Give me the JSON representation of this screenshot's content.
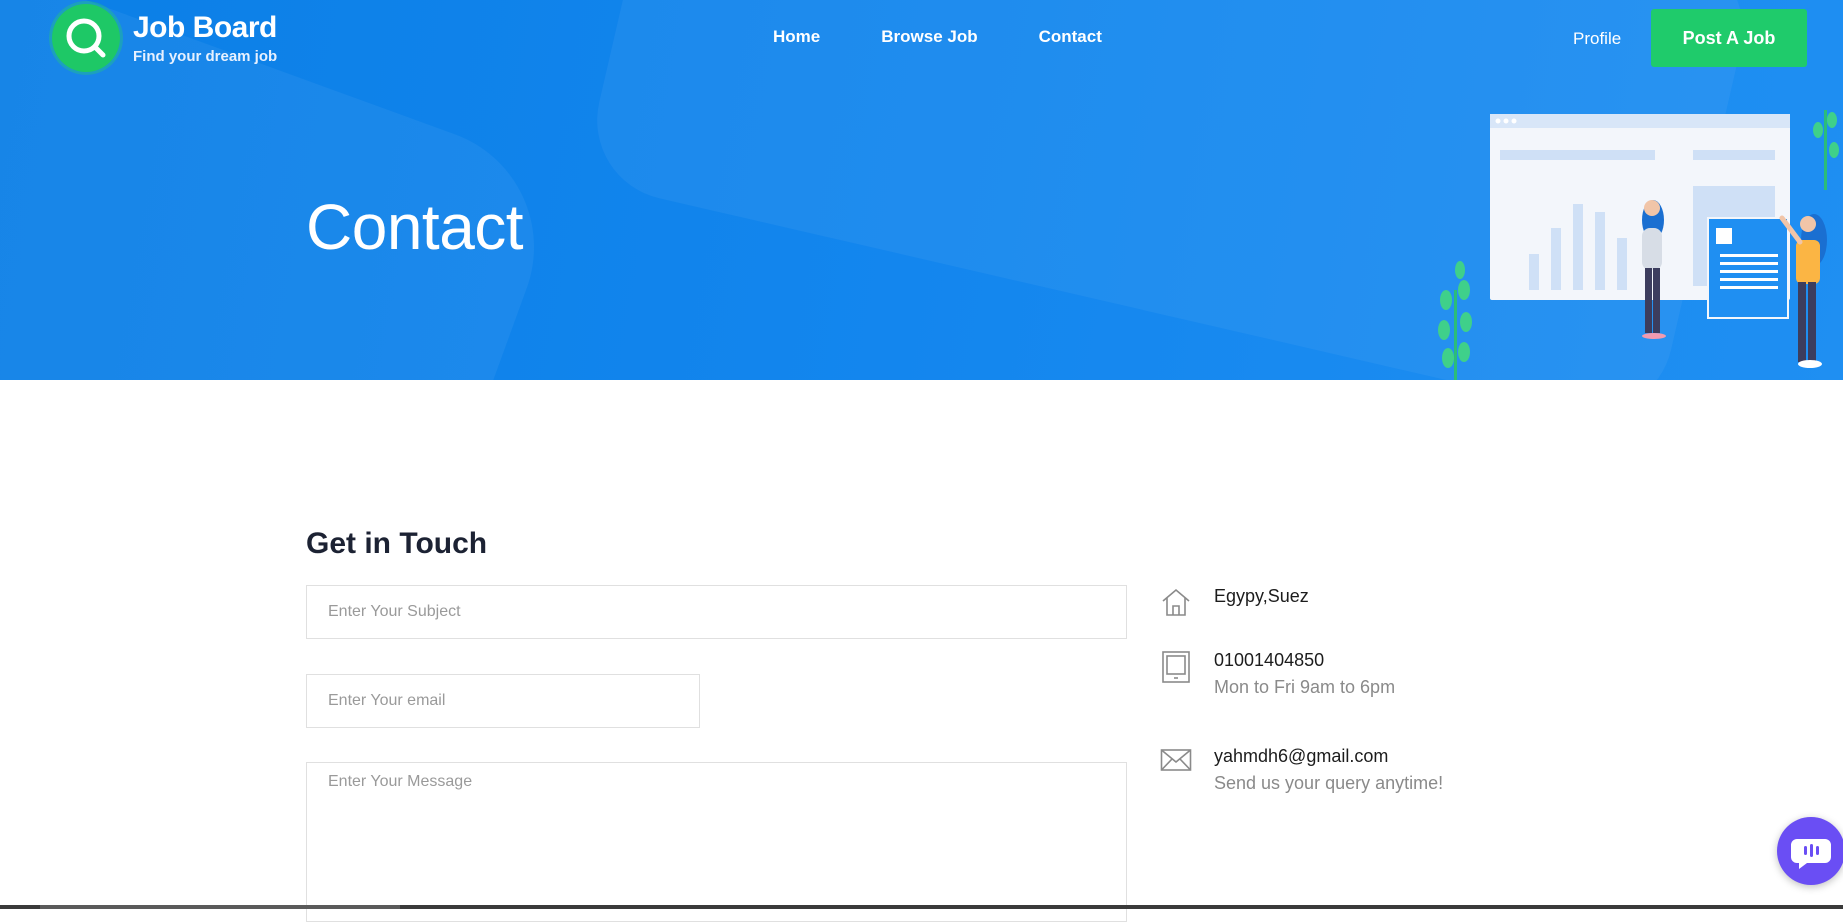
{
  "brand": {
    "name": "Job Board",
    "tagline": "Find your dream job",
    "color_primary": "#1386ee",
    "color_accent": "#1fcb6b"
  },
  "nav": {
    "items": [
      {
        "label": "Home"
      },
      {
        "label": "Browse Job"
      },
      {
        "label": "Contact"
      }
    ],
    "profile_label": "Profile",
    "post_job_label": "Post A Job"
  },
  "hero": {
    "title": "Contact"
  },
  "contact_form": {
    "heading": "Get in Touch",
    "subject_placeholder": "Enter Your Subject",
    "email_placeholder": "Enter Your email",
    "message_placeholder": "Enter Your Message"
  },
  "contact_info": {
    "address": {
      "icon": "home-icon",
      "line1": "Egypy,Suez"
    },
    "phone": {
      "icon": "tablet-icon",
      "line1": "01001404850",
      "line2": "Mon to Fri 9am to 6pm"
    },
    "email": {
      "icon": "envelope-icon",
      "line1": "yahmdh6@gmail.com",
      "line2": "Send us your query anytime!"
    }
  },
  "chat_widget": {
    "icon": "chat-bubble-icon",
    "color": "#6a4ef4"
  }
}
